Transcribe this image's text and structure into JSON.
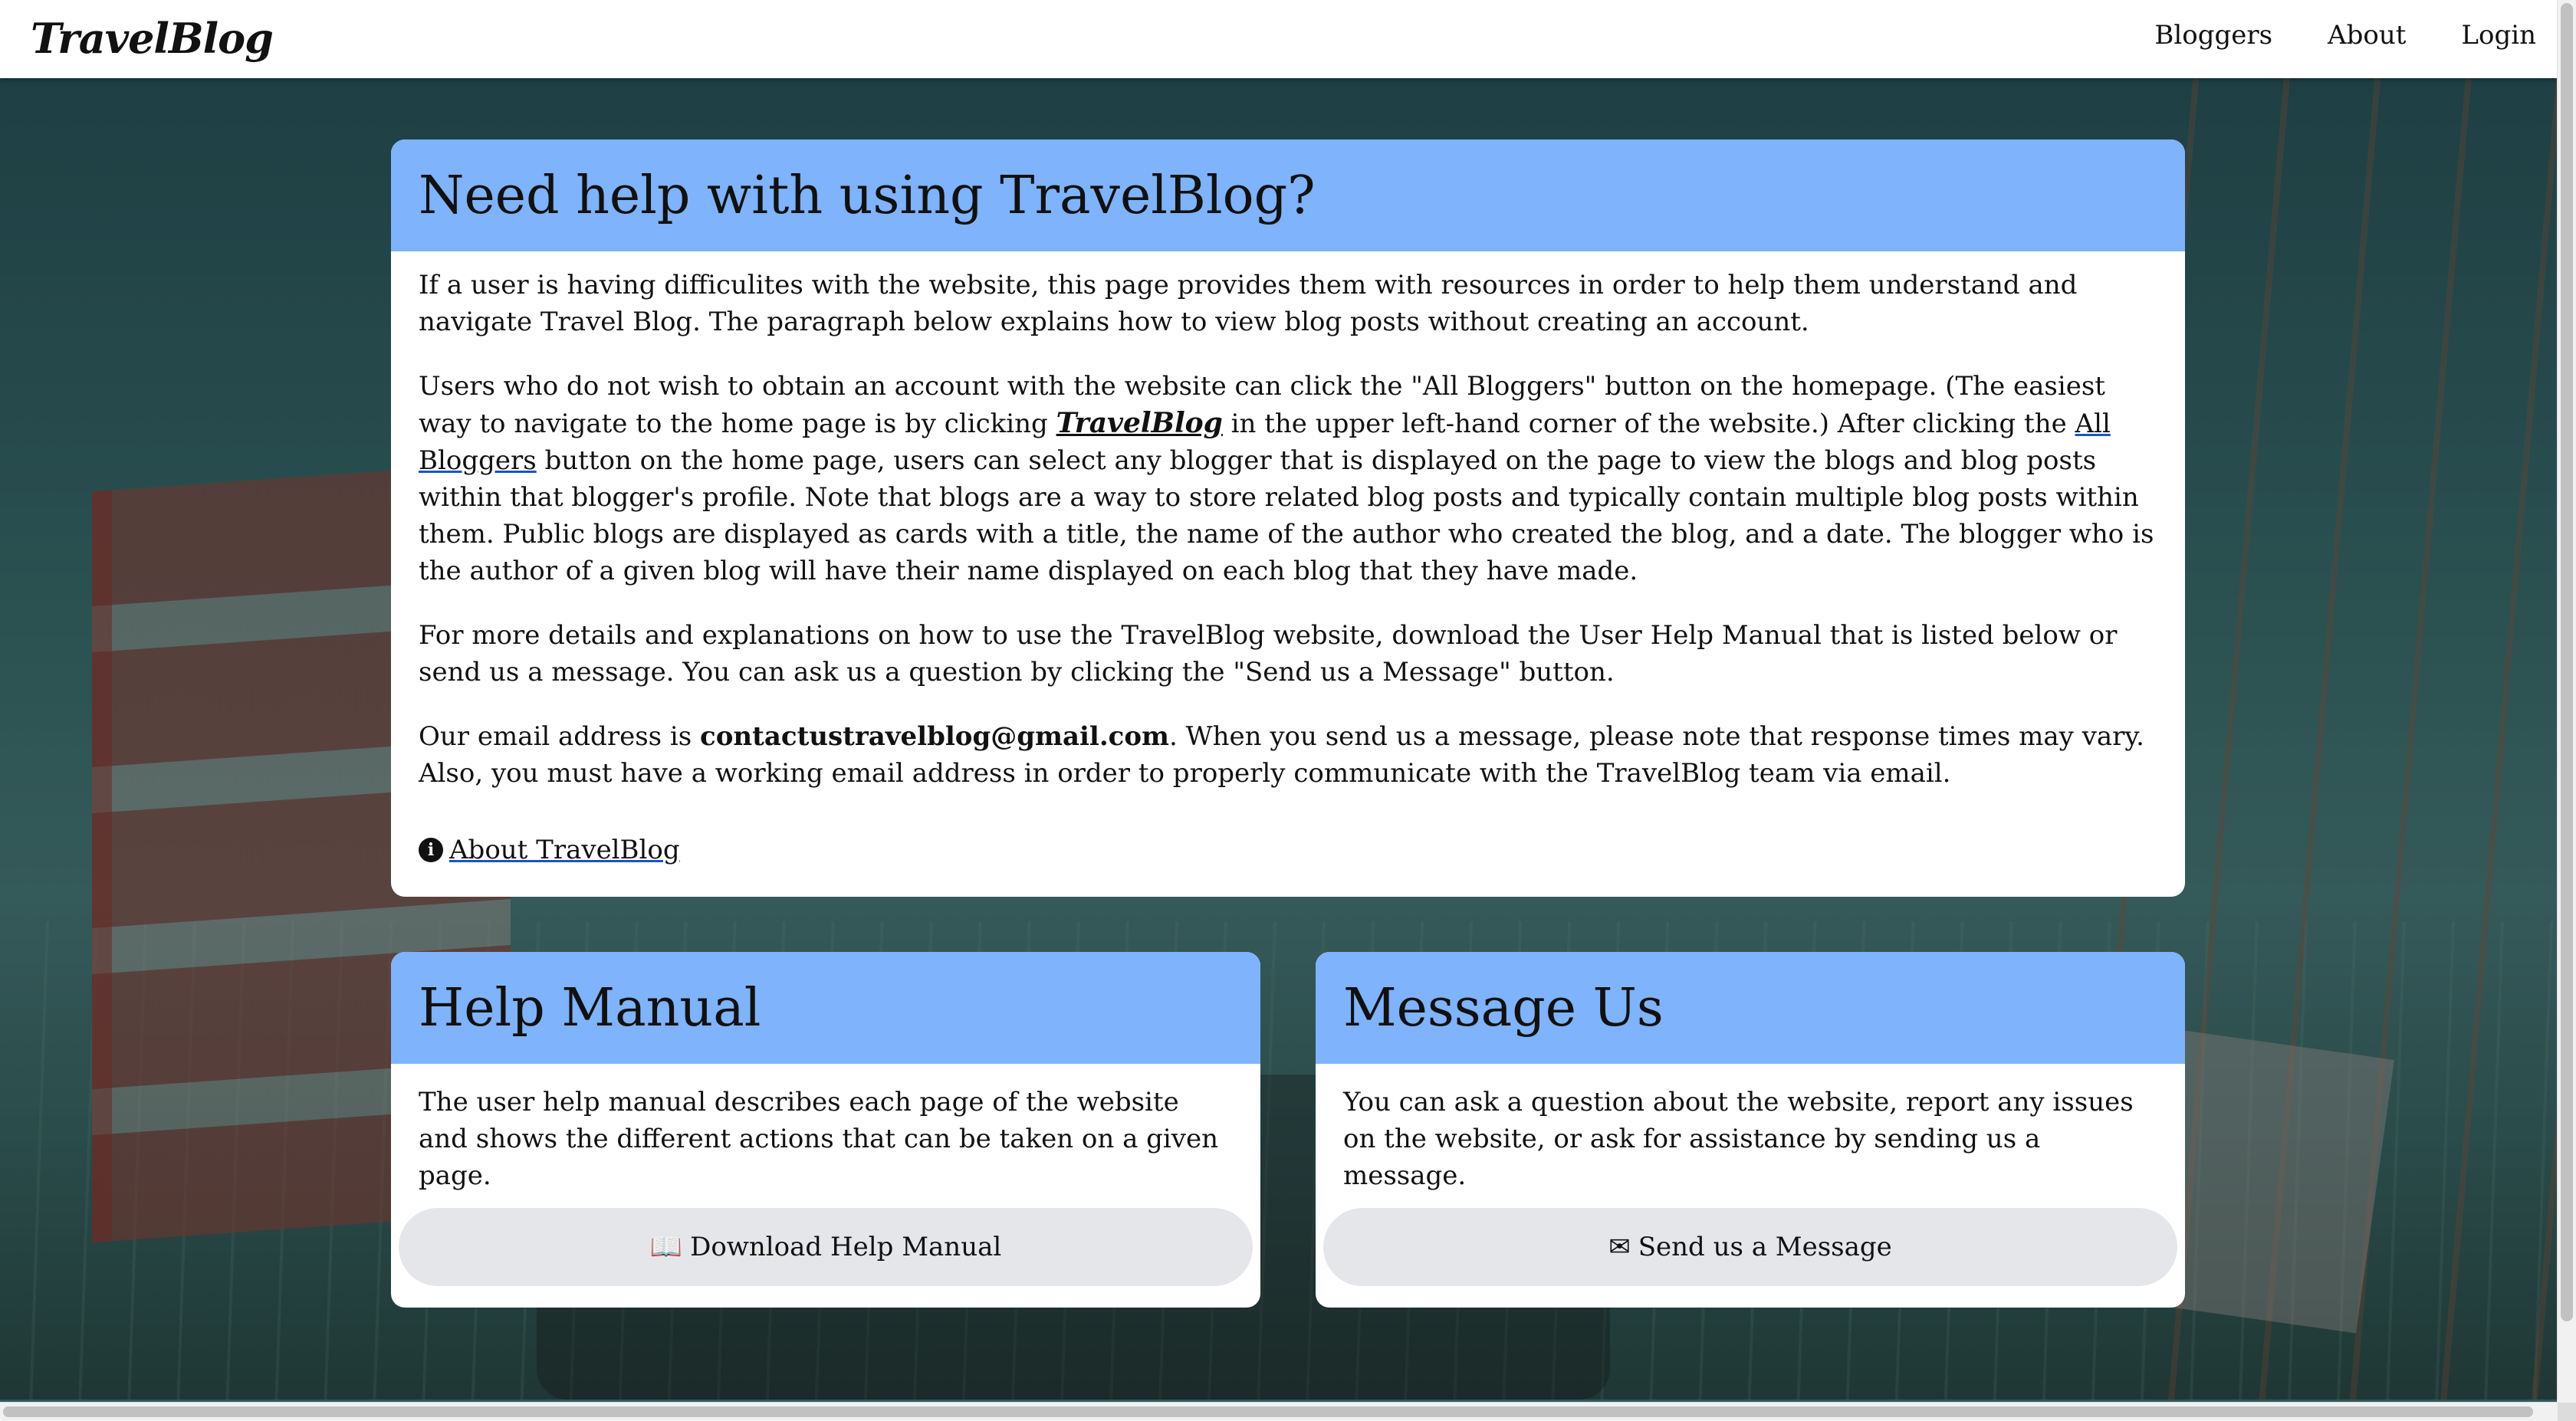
{
  "navbar": {
    "brand": "TravelBlog",
    "links": [
      "Bloggers",
      "About",
      "Login"
    ]
  },
  "help": {
    "title": "Need help with using TravelBlog?",
    "p1": "If a user is having difficulites with the website, this page provides them with resources in order to help them understand and navigate Travel Blog. The paragraph below explains how to view blog posts without creating an account.",
    "p2_a": "Users who do not wish to obtain an account with the website can click the \"All Bloggers\" button on the homepage. (The easiest way to navigate to the home page is by clicking ",
    "p2_brand": "TravelBlog",
    "p2_b": " in the upper left-hand corner of the website.) After clicking the ",
    "p2_link": "All Bloggers",
    "p2_c": " button on the home page, users can select any blogger that is displayed on the page to view the blogs and blog posts within that blogger's profile. Note that blogs are a way to store related blog posts and typically contain multiple blog posts within them. Public blogs are displayed as cards with a title, the name of the author who created the blog, and a date. The blogger who is the author of a given blog will have their name displayed on each blog that they have made.",
    "p3": "For more details and explanations on how to use the TravelBlog website, download the User Help Manual that is listed below or send us a message. You can ask us a question by clicking the \"Send us a Message\" button.",
    "p4_a": "Our email address is ",
    "p4_email": "contactustravelblog@gmail.com",
    "p4_b": ". When you send us a message, please note that response times may vary. Also, you must have a working email address in order to properly communicate with the TravelBlog team via email.",
    "about_link": "About TravelBlog",
    "about_icon": "info-circle-icon"
  },
  "manual": {
    "title": "Help Manual",
    "body": "The user help manual describes each page of the website and shows the different actions that can be taken on a given page.",
    "button": "Download Help Manual",
    "button_icon": "book-icon"
  },
  "message": {
    "title": "Message Us",
    "body": "You can ask a question about the website, report any issues on the website, or ask for assistance by sending us a message.",
    "button": "Send us a Message",
    "button_icon": "envelope-icon"
  },
  "colors": {
    "card_header": "#7fb3fb",
    "button_bg": "#e5e6ea",
    "link_underline": "#1a55c0"
  }
}
